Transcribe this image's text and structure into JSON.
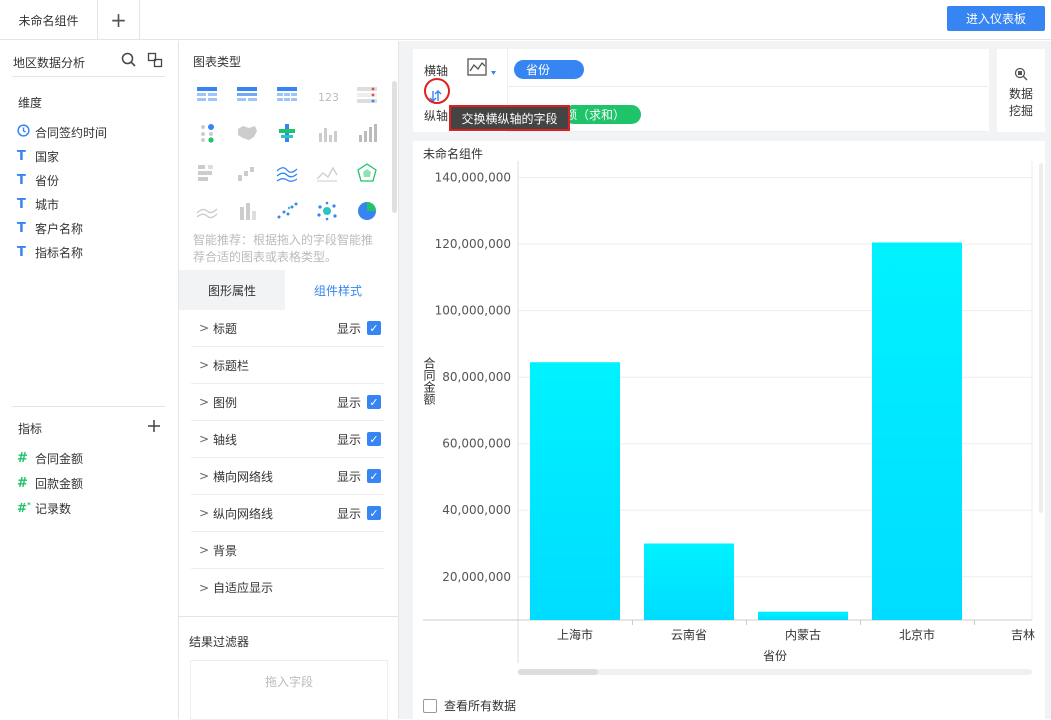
{
  "topbar": {
    "tab_label": "未命名组件",
    "add_tab": "+",
    "enter_dashboard": "进入仪表板"
  },
  "left_panel": {
    "dataset_title": "地区数据分析",
    "dimensions_label": "维度",
    "dimensions": [
      {
        "icon": "clock-icon",
        "label": "合同签约时间"
      },
      {
        "icon": "text-type-icon",
        "label": "国家"
      },
      {
        "icon": "text-type-icon",
        "label": "省份"
      },
      {
        "icon": "text-type-icon",
        "label": "城市"
      },
      {
        "icon": "text-type-icon",
        "label": "客户名称"
      },
      {
        "icon": "text-type-icon",
        "label": "指标名称"
      }
    ],
    "measures_label": "指标",
    "measures": [
      {
        "icon": "number-type-icon",
        "label": "合同金额"
      },
      {
        "icon": "number-type-icon",
        "label": "回款金额"
      },
      {
        "icon": "count-type-icon",
        "label": "记录数"
      }
    ]
  },
  "middle_panel": {
    "chart_type_title": "图表类型",
    "hint": "智能推荐：根据拖入的字段智能推荐合适的图表或表格类型。",
    "tabs": [
      "图形属性",
      "组件样式"
    ],
    "active_tab": "组件样式",
    "properties": [
      {
        "label": "标题",
        "show_text": "显示",
        "checked": true
      },
      {
        "label": "标题栏",
        "show_text": "",
        "checked": false
      },
      {
        "label": "图例",
        "show_text": "显示",
        "checked": true
      },
      {
        "label": "轴线",
        "show_text": "显示",
        "checked": true
      },
      {
        "label": "横向网络线",
        "show_text": "显示",
        "checked": true
      },
      {
        "label": "纵向网络线",
        "show_text": "显示",
        "checked": true
      },
      {
        "label": "背景",
        "show_text": "",
        "checked": false
      },
      {
        "label": "自适应显示",
        "show_text": "",
        "checked": false
      }
    ],
    "filter_title": "结果过滤器",
    "filter_placeholder": "拖入字段"
  },
  "axis_config": {
    "x_axis_label": "横轴",
    "y_axis_label": "纵轴",
    "x_field": "省份",
    "y_field_partial": "额",
    "y_field_agg": "（求和）",
    "tooltip": "交换横纵轴的字段",
    "data_mining": [
      "数据",
      "挖掘"
    ],
    "pill_blue": "#3685f2",
    "pill_green": "#1ec36a"
  },
  "chart": {
    "component_title": "未命名组件",
    "view_all_label": "查看所有数据",
    "bar_color": "#00e5ff"
  },
  "chart_data": {
    "type": "bar",
    "xlabel": "省份",
    "ylabel": "合同金额",
    "categories": [
      "上海市",
      "云南省",
      "内蒙古",
      "北京市",
      "吉林"
    ],
    "values": [
      84500000,
      30000000,
      9500000,
      120500000,
      null
    ],
    "ylim": [
      7000000,
      145000000
    ],
    "yticks": [
      "20,000,000",
      "40,000,000",
      "60,000,000",
      "80,000,000",
      "100,000,000",
      "120,000,000",
      "140,000,000"
    ],
    "grid": "horizontal"
  }
}
